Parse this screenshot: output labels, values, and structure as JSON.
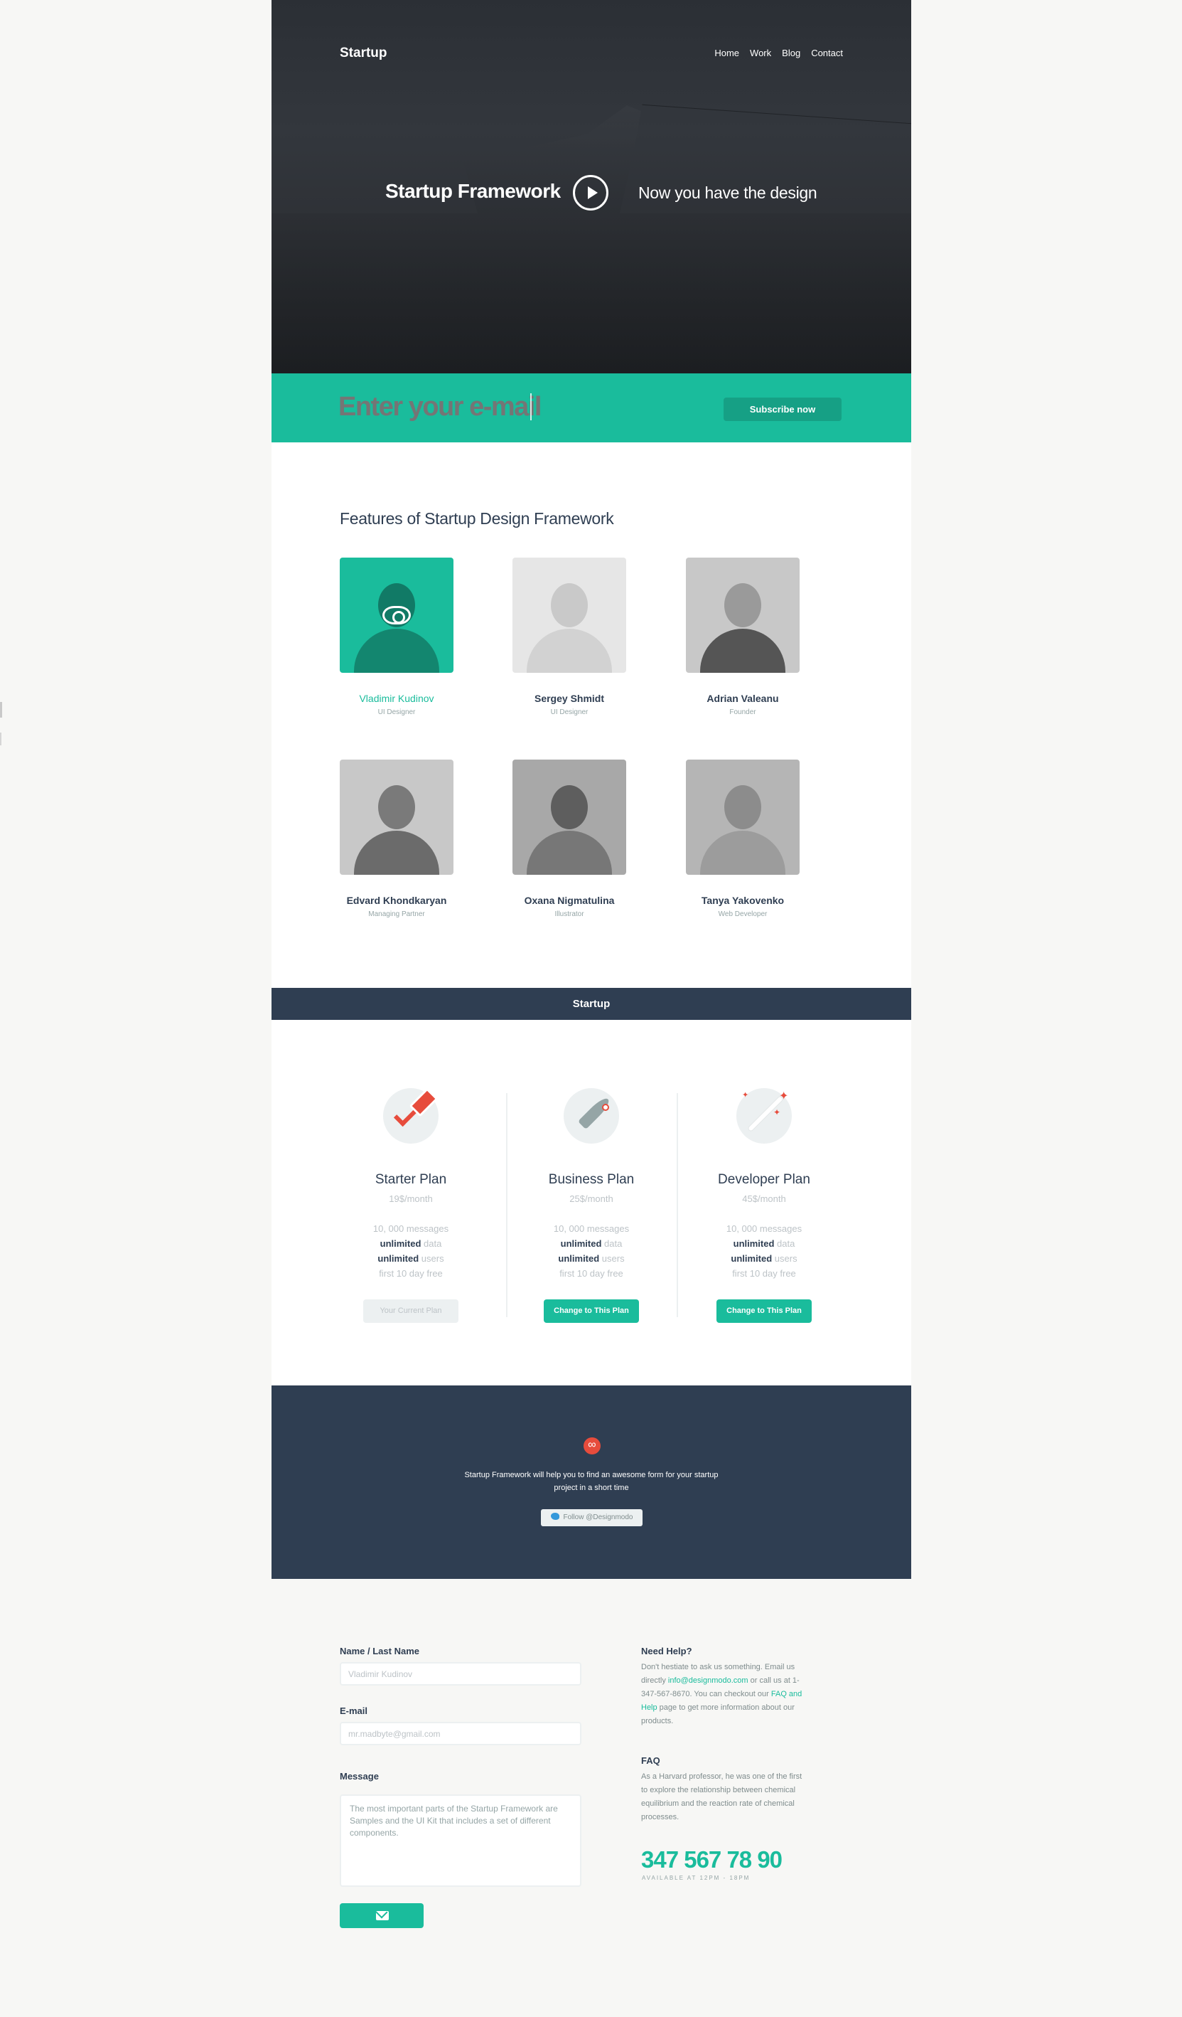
{
  "header": {
    "brand": "Startup",
    "nav": [
      "Home",
      "Work",
      "Blog",
      "Contact"
    ]
  },
  "hero": {
    "title": "Startup Framework",
    "subtitle": "Now you have the design"
  },
  "subscribe": {
    "placeholder": "Enter your e-mail",
    "button": "Subscribe now"
  },
  "team": {
    "title": "Features of Startup Design Framework",
    "members": [
      {
        "name": "Vladimir Kudinov",
        "role": "UI Designer"
      },
      {
        "name": "Sergey Shmidt",
        "role": "UI Designer"
      },
      {
        "name": "Adrian Valeanu",
        "role": "Founder"
      },
      {
        "name": "Edvard Khondkaryan",
        "role": "Managing Partner"
      },
      {
        "name": "Oxana Nigmatulina",
        "role": "Illustrator"
      },
      {
        "name": "Tanya Yakovenko",
        "role": "Web Developer"
      }
    ]
  },
  "bar": {
    "title": "Startup"
  },
  "pricing": {
    "plans": [
      {
        "name": "Starter Plan",
        "price": "19$/month",
        "messages": "10, 000 messages",
        "data_b": "unlimited",
        "data": " data",
        "users_b": "unlimited",
        "users": " users",
        "trial": "first 10 day free",
        "button": "Your Current Plan"
      },
      {
        "name": "Business Plan",
        "price": "25$/month",
        "messages": "10, 000 messages",
        "data_b": "unlimited",
        "data": " data",
        "users_b": "unlimited",
        "users": " users",
        "trial": "first 10 day free",
        "button": "Change to This Plan"
      },
      {
        "name": "Developer Plan",
        "price": "45$/month",
        "messages": "10, 000 messages",
        "data_b": "unlimited",
        "data": " data",
        "users_b": "unlimited",
        "users": " users",
        "trial": "first 10 day free",
        "button": "Change to This Plan"
      }
    ]
  },
  "promo": {
    "text": "Startup Framework will help you to find an awesome form for your startup project in a short time",
    "button": "Follow @Designmodo"
  },
  "contact": {
    "name_label": "Name / Last Name",
    "name_placeholder": "Vladimir Kudinov",
    "email_label": "E-mail",
    "email_placeholder": "mr.madbyte@gmail.com",
    "message_label": "Message",
    "message_value": "The most important parts of the Startup Framework are Samples and the UI Kit that includes a set of different components.",
    "help_title": "Need Help?",
    "help_1": "Don't hestiate to ask us something. Email us directly ",
    "help_email": "info@designmodo.com",
    "help_2": " or call us at 1-347-567-8670. You can checkout our ",
    "help_link": "FAQ and Help",
    "help_3": " page to get more information about our products.",
    "faq_title": "FAQ",
    "faq_text": "As a Harvard professor, he was one of the first to explore the relationship between chemical equilibrium and the reaction rate of chemical processes.",
    "phone": "347 567 78 90",
    "available": "AVAILABLE AT 12PM - 18PM"
  },
  "colors": {
    "accent": "#1abc9c",
    "dark": "#2f3e52",
    "red": "#e74c3c"
  },
  "icons": [
    "play-icon",
    "eye-icon",
    "checkmark-icon",
    "rocket-icon",
    "magic-wand-icon",
    "infinity-logo-icon",
    "twitter-icon",
    "envelope-icon"
  ]
}
